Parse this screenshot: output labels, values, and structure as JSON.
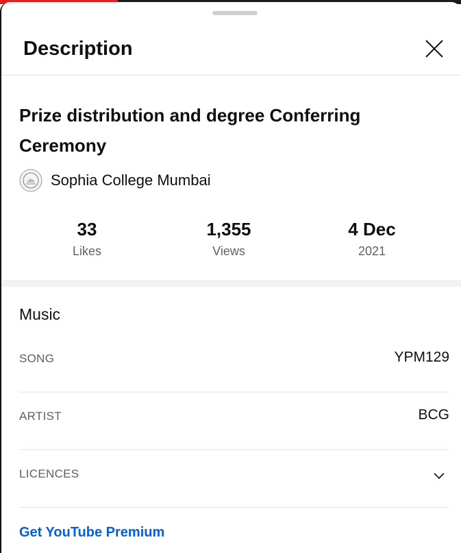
{
  "header": {
    "title": "Description"
  },
  "video": {
    "title": "Prize distribution and degree Conferring Ceremony",
    "channel_name": "Sophia College Mumbai",
    "channel_avatar_icon": "sophia-college-emblem-icon"
  },
  "stats": [
    {
      "value": "33",
      "label": "Likes"
    },
    {
      "value": "1,355",
      "label": "Views"
    },
    {
      "value": "4 Dec",
      "label": "2021"
    }
  ],
  "music": {
    "section_title": "Music",
    "rows": [
      {
        "key": "SONG",
        "value": "YPM129"
      },
      {
        "key": "ARTIST",
        "value": "BCG"
      },
      {
        "key": "LICENCES",
        "value": "",
        "icon": "chevron-down-icon"
      }
    ]
  },
  "link": {
    "label": "Get YouTube Premium"
  },
  "colors": {
    "accent_link": "#065fd4",
    "top_strip_red": "#e81c1c",
    "muted_text": "#606060"
  }
}
